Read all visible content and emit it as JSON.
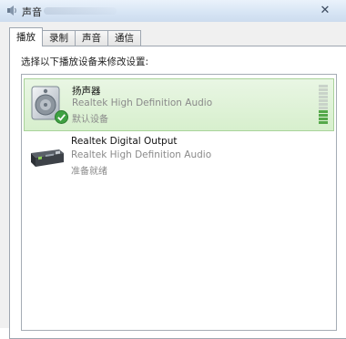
{
  "window": {
    "title": "声音",
    "close_glyph": "✕"
  },
  "tabs": [
    {
      "label": "播放",
      "active": true
    },
    {
      "label": "录制",
      "active": false
    },
    {
      "label": "声音",
      "active": false
    },
    {
      "label": "通信",
      "active": false
    }
  ],
  "panel": {
    "instruction": "选择以下播放设备来修改设置:"
  },
  "devices": [
    {
      "name": "扬声器",
      "driver": "Realtek High Definition Audio",
      "status": "默认设备",
      "icon": "speaker-icon",
      "selected": true,
      "default_check": true,
      "meter_level": 0.36
    },
    {
      "name": "Realtek Digital Output",
      "driver": "Realtek High Definition Audio",
      "status": "准备就绪",
      "icon": "digital-output-icon",
      "selected": false,
      "default_check": false,
      "meter_level": 0
    }
  ],
  "colors": {
    "selection_bg": "#d7efcd",
    "highlight_annotation": "#d6323a",
    "meter_active": "#55a84a"
  }
}
